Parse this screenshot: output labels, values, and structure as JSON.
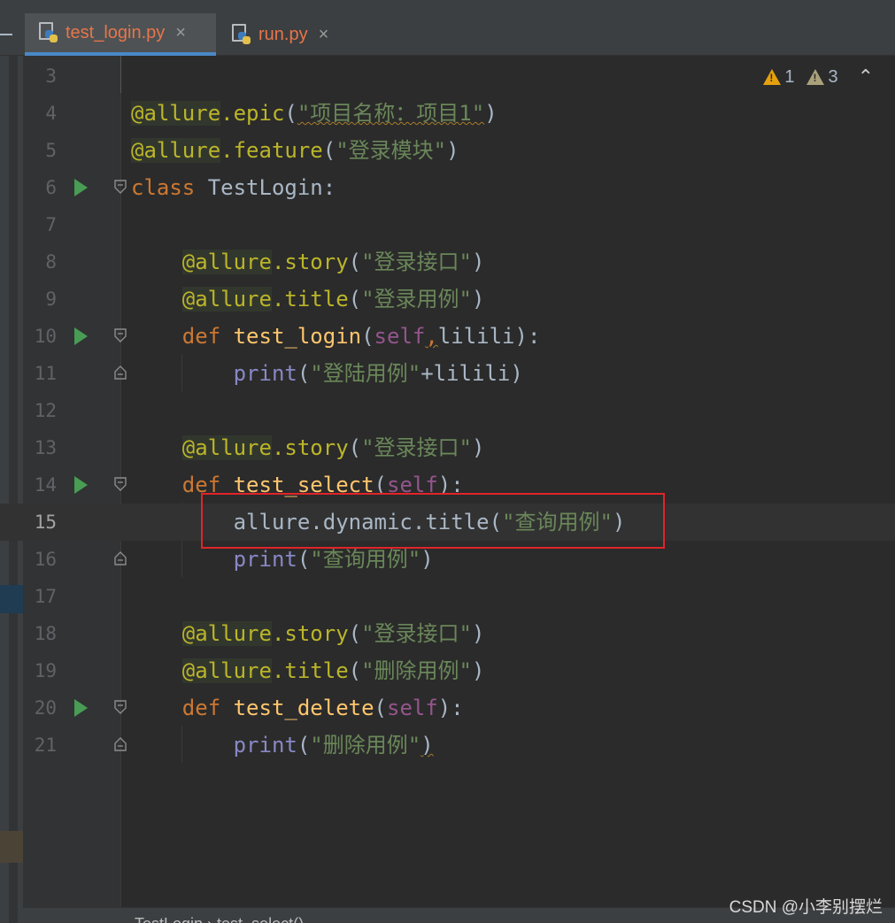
{
  "tabs": [
    {
      "label": "test_login.py",
      "active": true,
      "close": "×"
    },
    {
      "label": "run.py",
      "active": false,
      "close": "×"
    }
  ],
  "inspections": {
    "warnings": "1",
    "weak_warnings": "3",
    "nav_icon": "chevron-up-icon"
  },
  "lines": [
    {
      "n": "3"
    },
    {
      "n": "4"
    },
    {
      "n": "5"
    },
    {
      "n": "6"
    },
    {
      "n": "7"
    },
    {
      "n": "8"
    },
    {
      "n": "9"
    },
    {
      "n": "10"
    },
    {
      "n": "11"
    },
    {
      "n": "12"
    },
    {
      "n": "13"
    },
    {
      "n": "14"
    },
    {
      "n": "15"
    },
    {
      "n": "16"
    },
    {
      "n": "17"
    },
    {
      "n": "18"
    },
    {
      "n": "19"
    },
    {
      "n": "20"
    },
    {
      "n": "21"
    }
  ],
  "code": {
    "l4_str": "\"项目名称：项目1\"",
    "l5_str": "\"登录模块\"",
    "l6_class": "TestLogin",
    "l8_str": "\"登录接口\"",
    "l9_str": "\"登录用例\"",
    "l10_fn": "test_login",
    "l10_param": "lilili",
    "l11_str": "\"登陆用例\"",
    "l11_var": "lilili",
    "l13_str": "\"登录接口\"",
    "l14_fn": "test_select",
    "l15_str": "\"查询用例\"",
    "l16_str": "\"查询用例\"",
    "l18_str": "\"登录接口\"",
    "l19_str": "\"删除用例\"",
    "l20_fn": "test_delete",
    "l21_str": "\"删除用例\""
  },
  "breadcrumb": "TestLogin  ›  test_select()",
  "watermark": "CSDN @小李别摆烂",
  "colors": {
    "highlight": "#e0242a",
    "keyword": "#cc7832",
    "string": "#6a8759",
    "decorator": "#bbb529",
    "tab_accent": "#4a88c7"
  }
}
